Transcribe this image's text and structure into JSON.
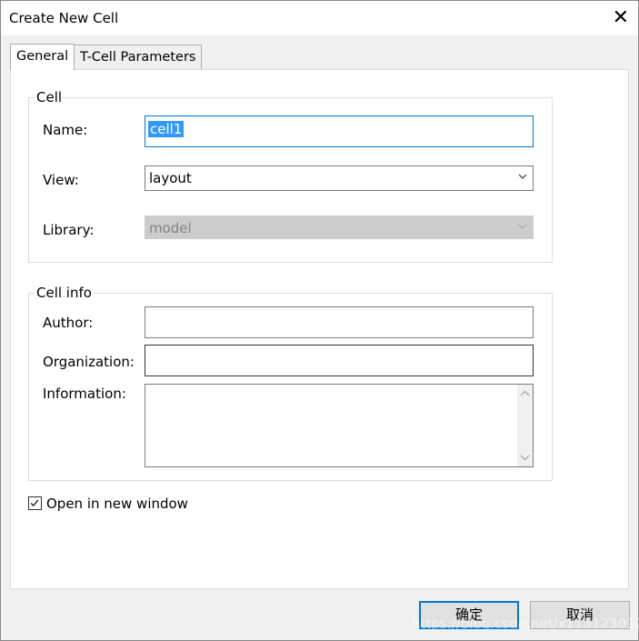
{
  "window": {
    "title": "Create New Cell"
  },
  "tabs": [
    {
      "label": "General",
      "active": true
    },
    {
      "label": "T-Cell Parameters",
      "active": false
    }
  ],
  "cell_group": {
    "legend": "Cell",
    "name_label": "Name:",
    "name_value": "cell1",
    "view_label": "View:",
    "view_value": "layout",
    "library_label": "Library:",
    "library_value": "model"
  },
  "info_group": {
    "legend": "Cell info",
    "author_label": "Author:",
    "author_value": "",
    "organization_label": "Organization:",
    "organization_value": "",
    "information_label": "Information:",
    "information_value": ""
  },
  "open_new_window": {
    "label": "Open in new window",
    "checked": true
  },
  "buttons": {
    "ok": "确定",
    "cancel": "取消"
  },
  "watermark": "https://blog.csdn.net/x1131230123",
  "colors": {
    "focus_border": "#0078d7",
    "selection": "#3399ff",
    "disabled_field": "#cccccc"
  }
}
